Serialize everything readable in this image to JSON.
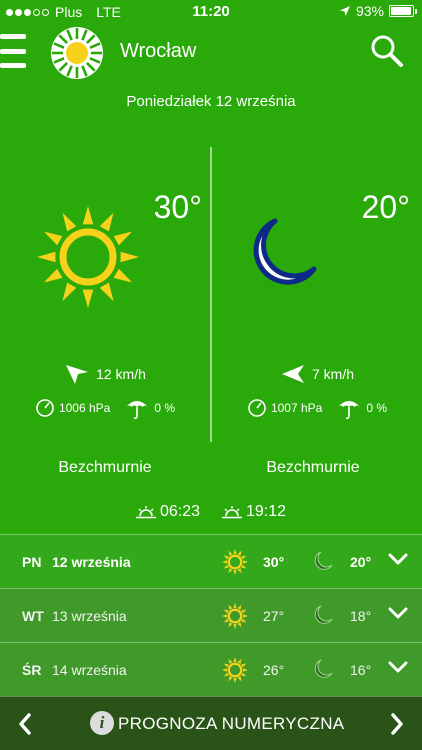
{
  "status_bar": {
    "carrier": "Plus",
    "network": "LTE",
    "time": "11:20",
    "battery": "93%",
    "battery_level": 0.93
  },
  "header": {
    "city": "Wrocław"
  },
  "date": "Poniedziałek 12 września",
  "day": {
    "temperature": "30°",
    "wind": "12 km/h",
    "pressure": "1006 hPa",
    "precip": "0 %",
    "description": "Bezchmurnie"
  },
  "night": {
    "temperature": "20°",
    "wind": "7 km/h",
    "pressure": "1007 hPa",
    "precip": "0 %",
    "description": "Bezchmurnie"
  },
  "sunrise": "06:23",
  "sunset": "19:12",
  "forecast": [
    {
      "day": "PN",
      "date": "12 września",
      "max": "30°",
      "min": "20°"
    },
    {
      "day": "WT",
      "date": "13 września",
      "max": "27°",
      "min": "18°"
    },
    {
      "day": "ŚR",
      "date": "14 września",
      "max": "26°",
      "min": "16°"
    }
  ],
  "footer": {
    "label": "PROGNOZA NUMERYCZNA"
  },
  "colors": {
    "background": "#2aa90a",
    "sun": "#f7d21a",
    "moon_outline": "#0c2a86",
    "footer": "#2a5318"
  }
}
